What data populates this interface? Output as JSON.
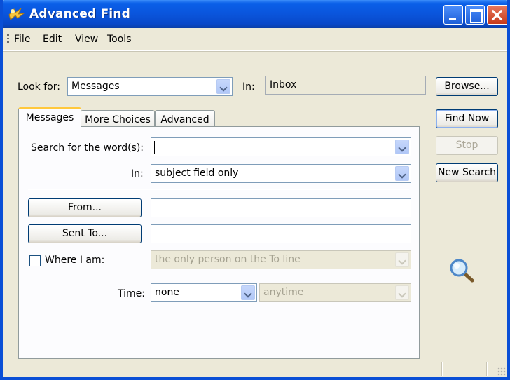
{
  "window": {
    "title": "Advanced Find"
  },
  "menu": {
    "items": [
      {
        "label": "File"
      },
      {
        "label": "Edit"
      },
      {
        "label": "View"
      },
      {
        "label": "Tools"
      }
    ]
  },
  "look_for": {
    "label": "Look for:",
    "value": "Messages",
    "in_label": "In:",
    "in_value": "Inbox"
  },
  "buttons": {
    "browse": "Browse...",
    "find_now": "Find Now",
    "stop": "Stop",
    "new_search": "New Search"
  },
  "tabs": [
    {
      "label": "Messages",
      "active": true
    },
    {
      "label": "More Choices",
      "active": false
    },
    {
      "label": "Advanced",
      "active": false
    }
  ],
  "messages_tab": {
    "search_label": "Search for the word(s):",
    "search_value": "",
    "in_label": "In:",
    "in_value": "subject field only",
    "from_button": "From...",
    "from_value": "",
    "sent_to_button": "Sent To...",
    "sent_to_value": "",
    "where_label": "Where I am:",
    "where_checked": false,
    "where_value": "the only person on the To line",
    "time_label": "Time:",
    "time_value": "none",
    "time_range_value": "anytime"
  },
  "colors": {
    "titlebar": "#0a55dc",
    "face": "#ece9d8",
    "active_tab_accent": "#ffc83c"
  }
}
